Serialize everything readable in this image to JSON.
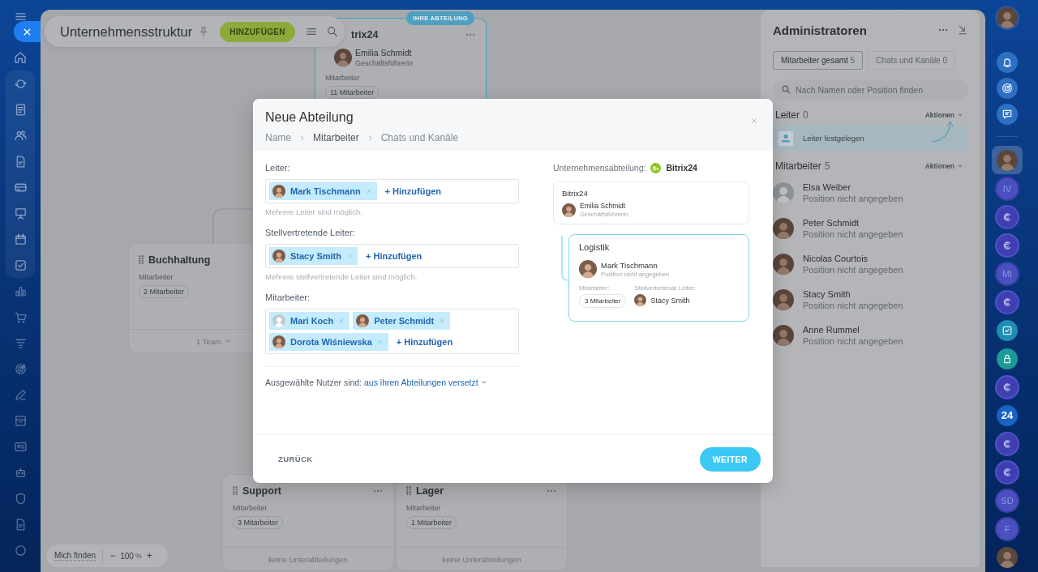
{
  "structure": {
    "title": "Unternehmensstruktur",
    "add_button": "HINZUFÜGEN",
    "departments": [
      {
        "name": "trix24",
        "badge": "IHRE ABTEILUNG",
        "head": {
          "name": "Emilia Schmidt",
          "position": "Geschäftsführerin",
          "kind": "photo"
        },
        "employees_label": "Mitarbeiter",
        "employees": "11 Mitarbeiter"
      },
      {
        "name": "Buchhaltung",
        "employees_label": "Mitarbeiter",
        "employees": "2 Mitarbeiter",
        "footer": "1 Team"
      },
      {
        "name": "Support",
        "employees_label": "Mitarbeiter",
        "employees": "3 Mitarbeiter",
        "footer": "keine Unterabteilungen"
      },
      {
        "name": "Lager",
        "employees_label": "Mitarbeiter",
        "employees": "1 Mitarbeiter",
        "footer": "keine Unterabteilungen"
      }
    ],
    "find_me": "Mich finden",
    "zoom_out": "−",
    "zoom": "100",
    "zoom_unit": "%",
    "zoom_in": "+"
  },
  "dialog": {
    "title": "Neue Abteilung",
    "steps": [
      {
        "label": "Name",
        "selected": false
      },
      {
        "label": "Mitarbeiter",
        "selected": true
      },
      {
        "label": "Chats und Kanäle",
        "selected": false
      }
    ],
    "fields": [
      {
        "label": "Leiter:",
        "people": [
          {
            "name": "Mark Tischmann",
            "kind": "photo"
          }
        ],
        "add": "+ Hinzufügen",
        "hint": "Mehrere Leiter sind möglich."
      },
      {
        "label": "Stellvertretende Leiter:",
        "people": [
          {
            "name": "Stacy Smith",
            "kind": "photo"
          }
        ],
        "add": "+ Hinzufügen",
        "hint": "Mehrere stellvertretende Leiter sind möglich."
      },
      {
        "label": "Mitarbeiter:",
        "people": [
          {
            "name": "Mari Koch",
            "kind": "placeholder"
          },
          {
            "name": "Peter Schmidt",
            "kind": "photo"
          },
          {
            "name": "Dorota Wiśniewska",
            "kind": "photo"
          }
        ],
        "add": "+ Hinzufügen"
      }
    ],
    "move_label": "Ausgewählte Nutzer sind:",
    "move_option": "aus ihren Abteilungen versetzt",
    "parent_label": "Unternehmensabteilung:",
    "parent_name": "Bitrix24",
    "preview": {
      "parent": {
        "name": "Bitrix24",
        "head": "Emilia Schmidt",
        "position": "Geschäftsführerin",
        "kind": "photo"
      },
      "child": {
        "name": "Logistik",
        "head": "Mark Tischmann",
        "position": "Position nicht angegeben",
        "kind": "photo",
        "employees_label": "Mitarbeiter:",
        "employees": "3 Mitarbeiter",
        "deputy_label": "Stellvertretende Leiter:",
        "deputy": {
          "name": "Stacy Smith",
          "kind": "photo"
        }
      }
    },
    "back": "ZURÜCK",
    "next": "WEITER"
  },
  "admins": {
    "title": "Administratoren",
    "tabs": [
      {
        "label": "Mitarbeiter gesamt",
        "count": "5",
        "selected": true
      },
      {
        "label": "Chats und Kanäle",
        "count": "0",
        "selected": false
      }
    ],
    "search_placeholder": "Nach Namen oder Position finden",
    "heads": {
      "title": "Leiter",
      "count": "0",
      "actions": "Aktionen",
      "hint": "Leiter festgelegen"
    },
    "members": {
      "title": "Mitarbeiter",
      "count": "5",
      "actions": "Aktionen",
      "people": [
        {
          "name": "Elsa Weiber",
          "position": "Position nicht angegeben",
          "kind": "placeholder"
        },
        {
          "name": "Peter Schmidt",
          "position": "Position nicht angegeben",
          "kind": "photo"
        },
        {
          "name": "Nicolas Courtois",
          "position": "Position nicht angegeben",
          "kind": "photo"
        },
        {
          "name": "Stacy Smith",
          "position": "Position nicht angegeben",
          "kind": "photo"
        },
        {
          "name": "Anne Rummel",
          "position": "Position nicht angegeben",
          "kind": "photo"
        }
      ]
    }
  },
  "right_rail": {
    "account": {
      "kind": "photo"
    },
    "tools": [
      {
        "kind": "bell"
      },
      {
        "kind": "target"
      },
      {
        "kind": "chat"
      }
    ],
    "chats": [
      {
        "kind": "photo",
        "selected": true
      },
      {
        "kind": "initials",
        "text": "IV",
        "selected": false
      },
      {
        "kind": "channel",
        "selected": false
      },
      {
        "kind": "channel",
        "selected": false
      },
      {
        "kind": "initials",
        "text": "MI",
        "selected": false
      },
      {
        "kind": "channel",
        "selected": false
      },
      {
        "kind": "task",
        "selected": false
      },
      {
        "kind": "lock",
        "selected": false
      },
      {
        "kind": "channel",
        "selected": false
      },
      {
        "kind": "logo",
        "text": "24",
        "selected": false
      },
      {
        "kind": "channel",
        "selected": false
      },
      {
        "kind": "channel",
        "selected": false
      },
      {
        "kind": "initials",
        "text": "SD",
        "selected": false
      },
      {
        "kind": "initials",
        "text": "F",
        "selected": false
      },
      {
        "kind": "photo",
        "selected": false
      }
    ]
  }
}
